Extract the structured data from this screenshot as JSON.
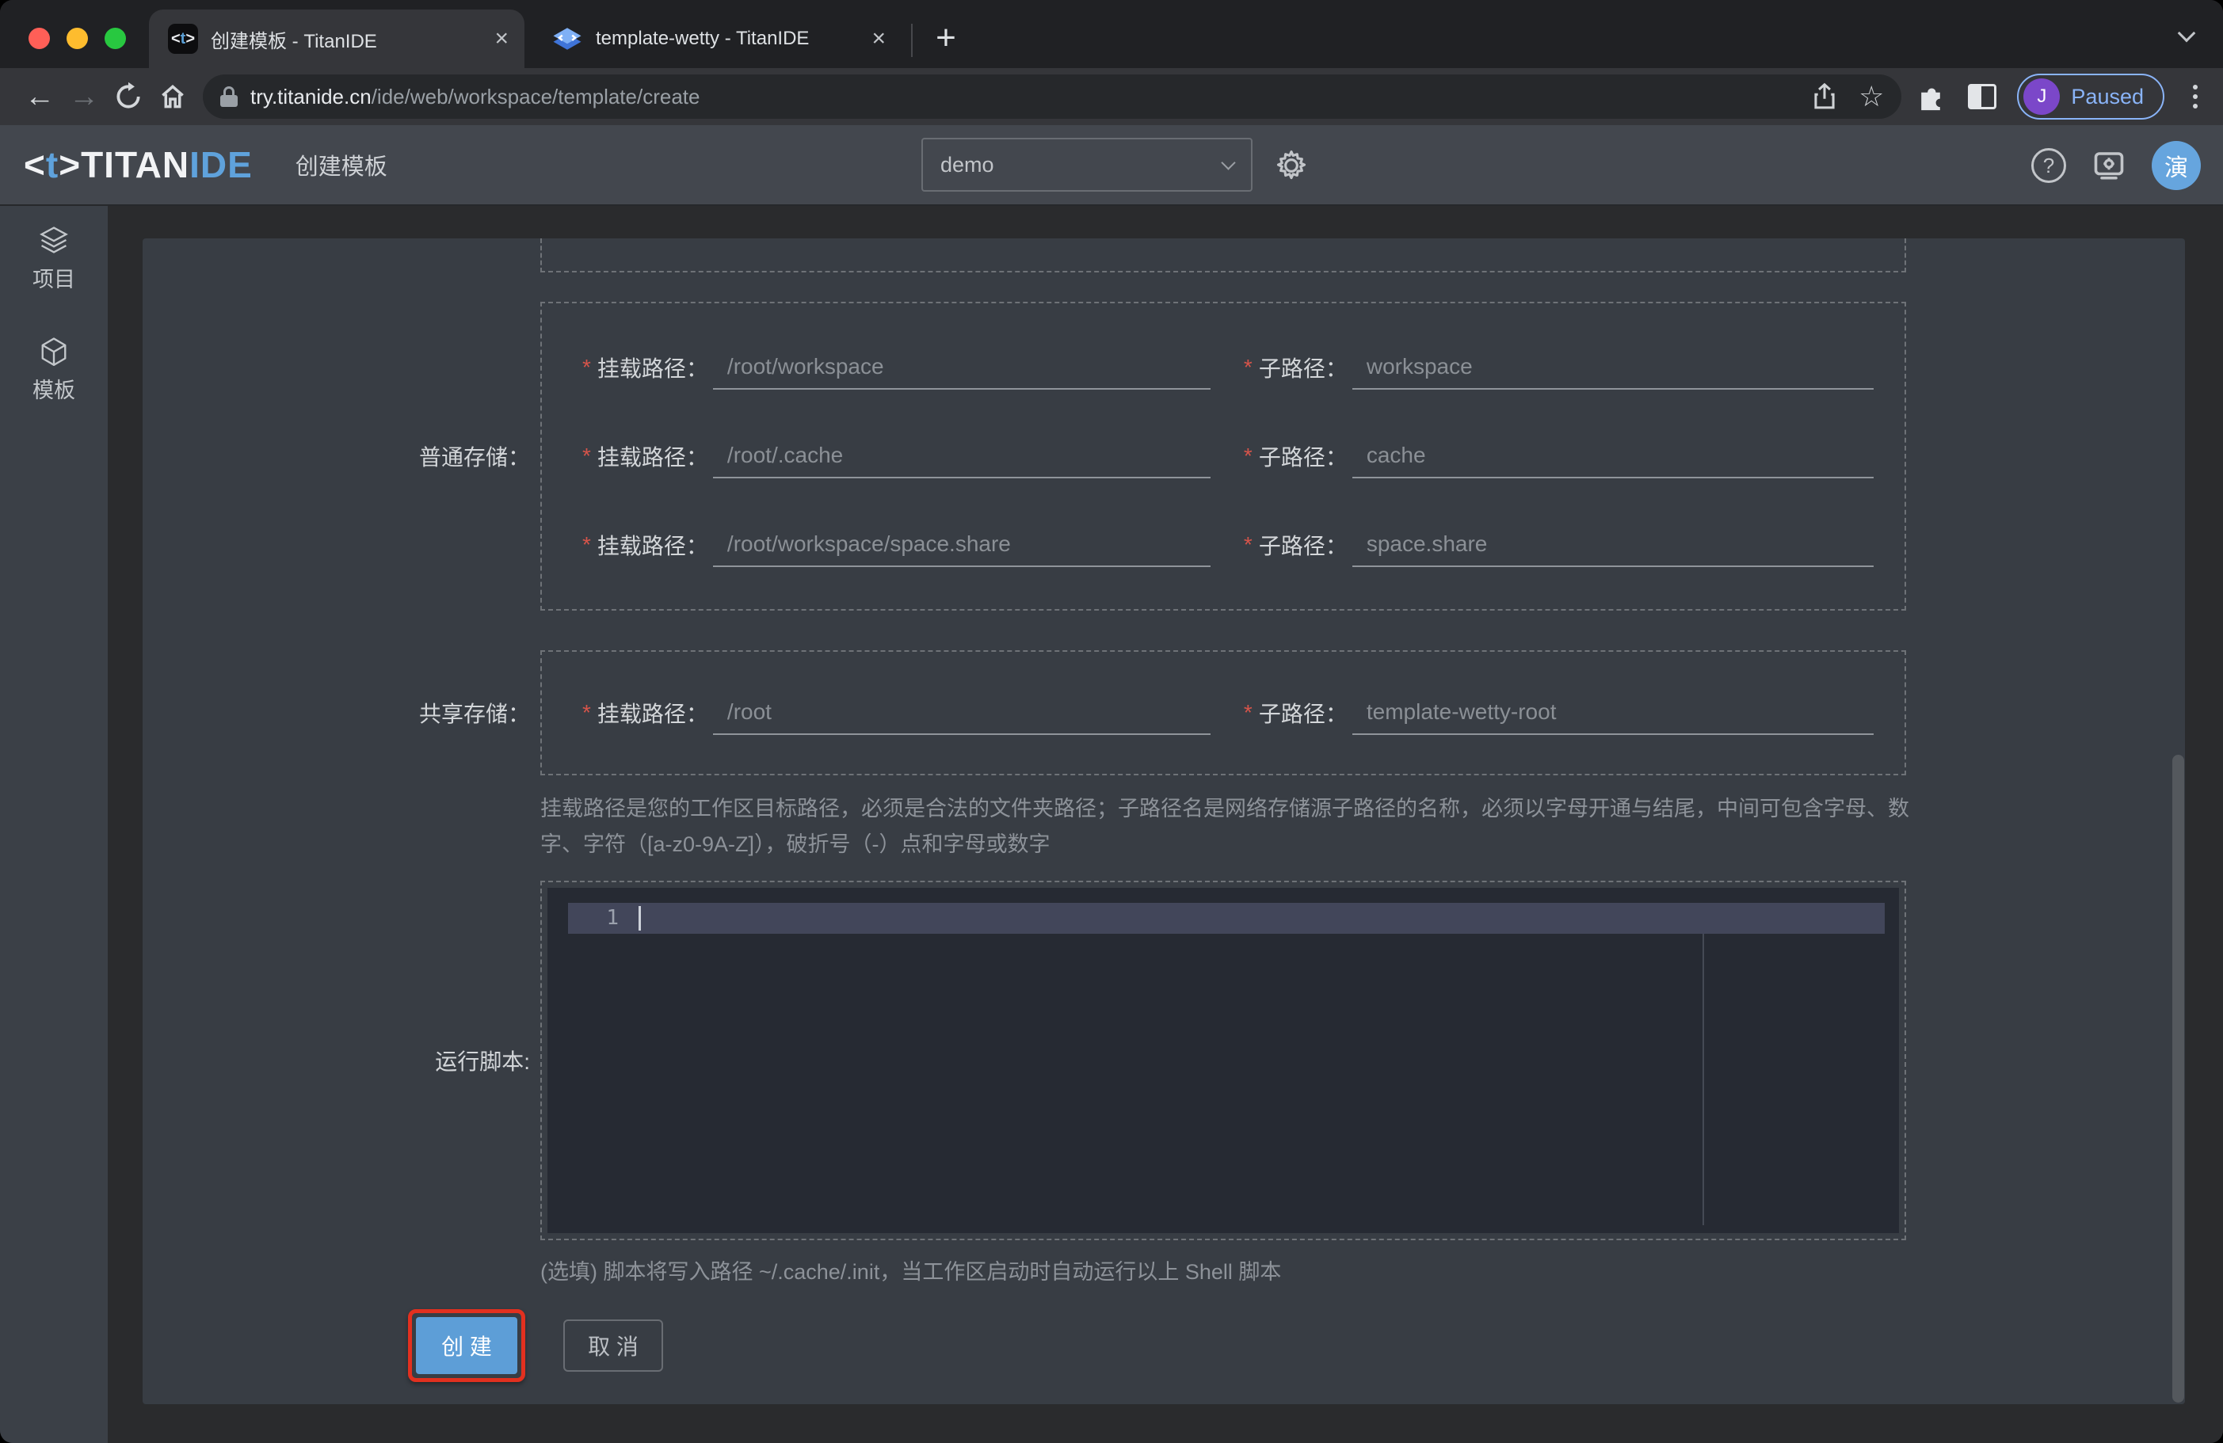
{
  "browser": {
    "tabs": [
      {
        "title": "创建模板 - TitanIDE"
      },
      {
        "title": "template-wetty - TitanIDE"
      }
    ],
    "glyphs": {
      "close": "×",
      "new_tab": "+",
      "back": "←",
      "forward": "→",
      "star": "☆"
    },
    "url": {
      "domain": "try.titanide.cn",
      "path": "/ide/web/workspace/template/create"
    },
    "profile": {
      "initial": "J",
      "status": "Paused"
    }
  },
  "header": {
    "logo": {
      "lb": "<",
      "t": "t",
      "rb": ">",
      "word1": "TITAN",
      "word2": "IDE"
    },
    "page_title": "创建模板",
    "workspace_select": {
      "value": "demo"
    },
    "help_glyph": "?",
    "avatar_text": "演"
  },
  "sidebar": {
    "items": [
      {
        "label": "项目"
      },
      {
        "label": "模板"
      }
    ]
  },
  "form": {
    "groups": [
      {
        "label": "普通存储：",
        "rows": [
          {
            "mount_label": "挂载路径：",
            "mount_placeholder": "/root/workspace",
            "sub_label": "子路径：",
            "sub_placeholder": "workspace"
          },
          {
            "mount_label": "挂载路径：",
            "mount_placeholder": "/root/.cache",
            "sub_label": "子路径：",
            "sub_placeholder": "cache"
          },
          {
            "mount_label": "挂载路径：",
            "mount_placeholder": "/root/workspace/space.share",
            "sub_label": "子路径：",
            "sub_placeholder": "space.share"
          }
        ]
      },
      {
        "label": "共享存储：",
        "rows": [
          {
            "mount_label": "挂载路径：",
            "mount_placeholder": "/root",
            "sub_label": "子路径：",
            "sub_placeholder": "template-wetty-root"
          }
        ]
      }
    ],
    "help_text": "挂载路径是您的工作区目标路径，必须是合法的文件夹路径；子路径名是网络存储源子路径的名称，必须以字母开通与结尾，中间可包含字母、数字、字符（[a-z0-9A-Z]），破折号（-）点和字母或数字",
    "script": {
      "label": "运行脚本:",
      "line_number": "1",
      "note": "(选填) 脚本将写入路径 ~/.cache/.init，当工作区启动时自动运行以上 Shell 脚本"
    },
    "buttons": {
      "create": "创 建",
      "cancel": "取 消"
    }
  },
  "colors": {
    "accent_blue": "#5d9ed7",
    "highlight_red": "#e2301f",
    "required_red": "#d5544a"
  }
}
